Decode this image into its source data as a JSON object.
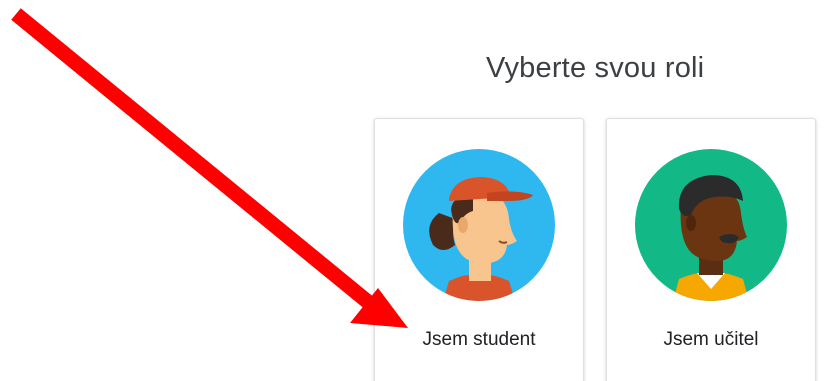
{
  "page": {
    "title": "Vyberte svou roli"
  },
  "roles": [
    {
      "label": "Jsem student",
      "avatar_icon": "student-avatar-icon",
      "avatar_bg": "#2fb7f0"
    },
    {
      "label": "Jsem učitel",
      "avatar_icon": "teacher-avatar-icon",
      "avatar_bg": "#12b886"
    }
  ],
  "annotation": {
    "icon": "red-arrow-icon",
    "color": "#ff0000"
  }
}
